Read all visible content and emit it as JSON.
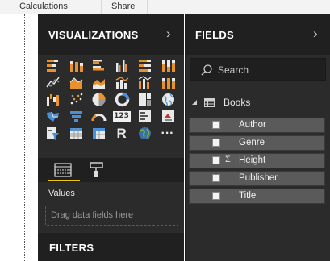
{
  "ribbon": {
    "groups": [
      "Calculations",
      "Share"
    ]
  },
  "visualizations": {
    "title": "VISUALIZATIONS",
    "icons": [
      "stacked-bar-chart",
      "stacked-column-chart",
      "clustered-bar-chart",
      "clustered-column-chart",
      "100-percent-stacked-bar-chart",
      "100-percent-stacked-column-chart",
      "line-chart",
      "area-chart",
      "stacked-area-chart",
      "line-and-stacked-column-chart",
      "line-and-clustered-column-chart",
      "ribbon-chart",
      "waterfall-chart",
      "scatter-chart",
      "pie-chart",
      "donut-chart",
      "treemap",
      "map",
      "filled-map",
      "funnel",
      "gauge",
      "card",
      "multi-row-card",
      "kpi",
      "slicer",
      "table",
      "matrix",
      "r-script-visual",
      "globe-map",
      "more-visuals"
    ],
    "card_text": "123",
    "r_text": "R",
    "more_text": "···",
    "tabs": [
      "fields-tab",
      "format-tab"
    ],
    "values_label": "Values",
    "dropzone_placeholder": "Drag data fields here",
    "filters_title": "FILTERS"
  },
  "fields": {
    "title": "FIELDS",
    "search_placeholder": "Search",
    "table_name": "Books",
    "items": [
      {
        "label": "Author",
        "sigma": ""
      },
      {
        "label": "Genre",
        "sigma": ""
      },
      {
        "label": "Height",
        "sigma": "Σ"
      },
      {
        "label": "Publisher",
        "sigma": ""
      },
      {
        "label": "Title",
        "sigma": ""
      }
    ]
  },
  "colors": {
    "panel": "#2b2b2b",
    "header": "#202020",
    "accent": "#f2c811",
    "icon_orange": "#e8922f",
    "icon_blue": "#4a90d9"
  }
}
